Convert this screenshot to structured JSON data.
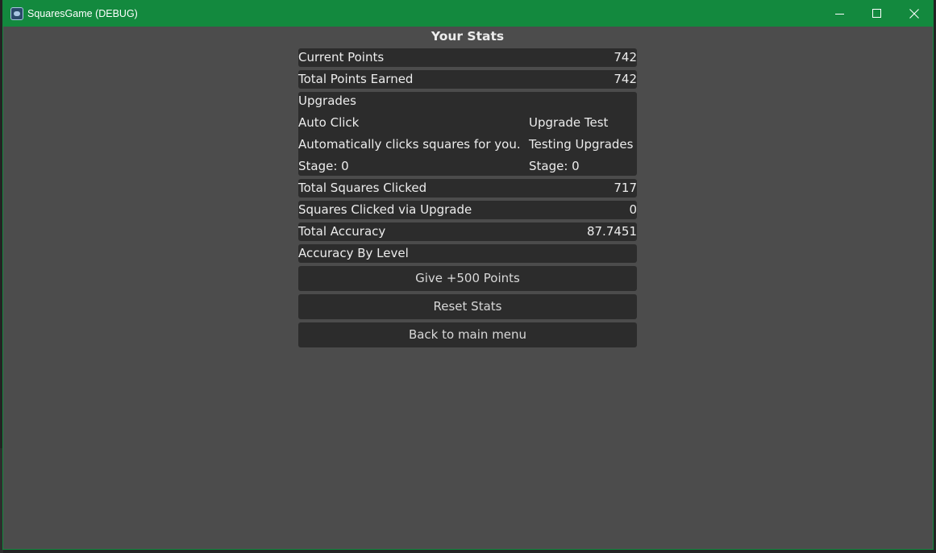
{
  "window": {
    "title": "SquaresGame (DEBUG)",
    "accent_color": "#13893e",
    "background_color": "#4c4c4c",
    "panel_color": "#2c2c2c",
    "controls": {
      "minimize_icon": "minimize-icon",
      "maximize_icon": "maximize-icon",
      "close_icon": "close-icon"
    }
  },
  "stats": {
    "heading": "Your Stats",
    "current_points": {
      "label": "Current Points",
      "value": "742"
    },
    "total_points_earned": {
      "label": "Total Points Earned",
      "value": "742"
    },
    "upgrades": {
      "heading": "Upgrades",
      "items": [
        {
          "name": "Auto Click",
          "description": "Automatically clicks squares for you.",
          "stage": "Stage: 0"
        },
        {
          "name": "Upgrade Test",
          "description": "Testing Upgrades",
          "stage": "Stage: 0"
        }
      ]
    },
    "total_squares_clicked": {
      "label": "Total Squares Clicked",
      "value": "717"
    },
    "squares_clicked_via_upgrade": {
      "label": "Squares Clicked via Upgrade",
      "value": "0"
    },
    "total_accuracy": {
      "label": "Total Accuracy",
      "value": "87.7451"
    },
    "accuracy_by_level": {
      "label": "Accuracy By Level"
    }
  },
  "buttons": {
    "give_points": "Give +500 Points",
    "reset_stats": "Reset Stats",
    "back_to_menu": "Back to main menu"
  }
}
